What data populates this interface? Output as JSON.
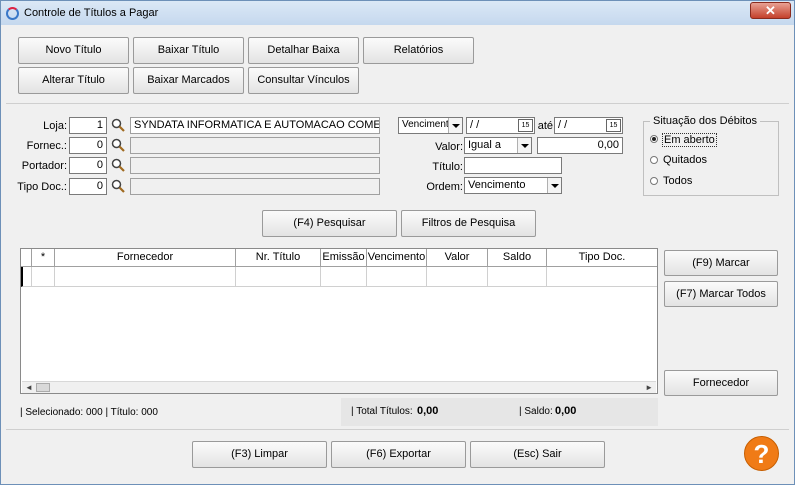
{
  "window": {
    "title": "Controle de Títulos a Pagar",
    "close_label": "✕"
  },
  "toolbar": {
    "novo_titulo": "Novo Título",
    "baixar_titulo": "Baixar Título",
    "detalhar_baixa": "Detalhar Baixa",
    "relatorios": "Relatórios",
    "alterar_titulo": "Alterar Título",
    "baixar_marcados": "Baixar Marcados",
    "consultar_vinculos": "Consultar Vínculos"
  },
  "filters": {
    "loja_label": "Loja:",
    "loja_value": "1",
    "loja_name": "SYNDATA INFORMATICA E AUTOMACAO COMERCIA",
    "fornec_label": "Fornec.:",
    "fornec_value": "0",
    "fornec_name": "",
    "portador_label": "Portador:",
    "portador_value": "0",
    "portador_name": "",
    "tipodoc_label": "Tipo Doc.:",
    "tipodoc_value": "0",
    "tipodoc_name": "",
    "date_type": "Vencimento",
    "date_from": " / /",
    "ate_label": "até",
    "date_to": " / /",
    "cal_day": "15",
    "valor_label": "Valor:",
    "valor_op": "Igual a",
    "valor_value": "0,00",
    "titulo_label": "Título:",
    "titulo_value": "",
    "ordem_label": "Ordem:",
    "ordem_value": "Vencimento"
  },
  "situacao": {
    "title": "Situação dos Débitos",
    "options": [
      "Em aberto",
      "Quitados",
      "Todos"
    ],
    "selected": "Em aberto"
  },
  "search": {
    "pesquisar": "(F4) Pesquisar",
    "filtros": "Filtros de Pesquisa"
  },
  "grid": {
    "columns": [
      "*",
      "Fornecedor",
      "Nr. Título",
      "Emissão",
      "Vencimento",
      "Valor",
      "Saldo",
      "Tipo Doc."
    ]
  },
  "side_buttons": {
    "marcar": "(F9) Marcar",
    "marcar_todos": "(F7) Marcar Todos",
    "fornecedor": "Fornecedor"
  },
  "status": {
    "selecionado": "| Selecionado: 000 | Título: 000",
    "total_titulos_label": "| Total Títulos:",
    "total_titulos_value": "0,00",
    "saldo_label": "| Saldo:",
    "saldo_value": "0,00"
  },
  "footer": {
    "limpar": "(F3) Limpar",
    "exportar": "(F6) Exportar",
    "sair": "(Esc) Sair"
  },
  "help_label": "?"
}
